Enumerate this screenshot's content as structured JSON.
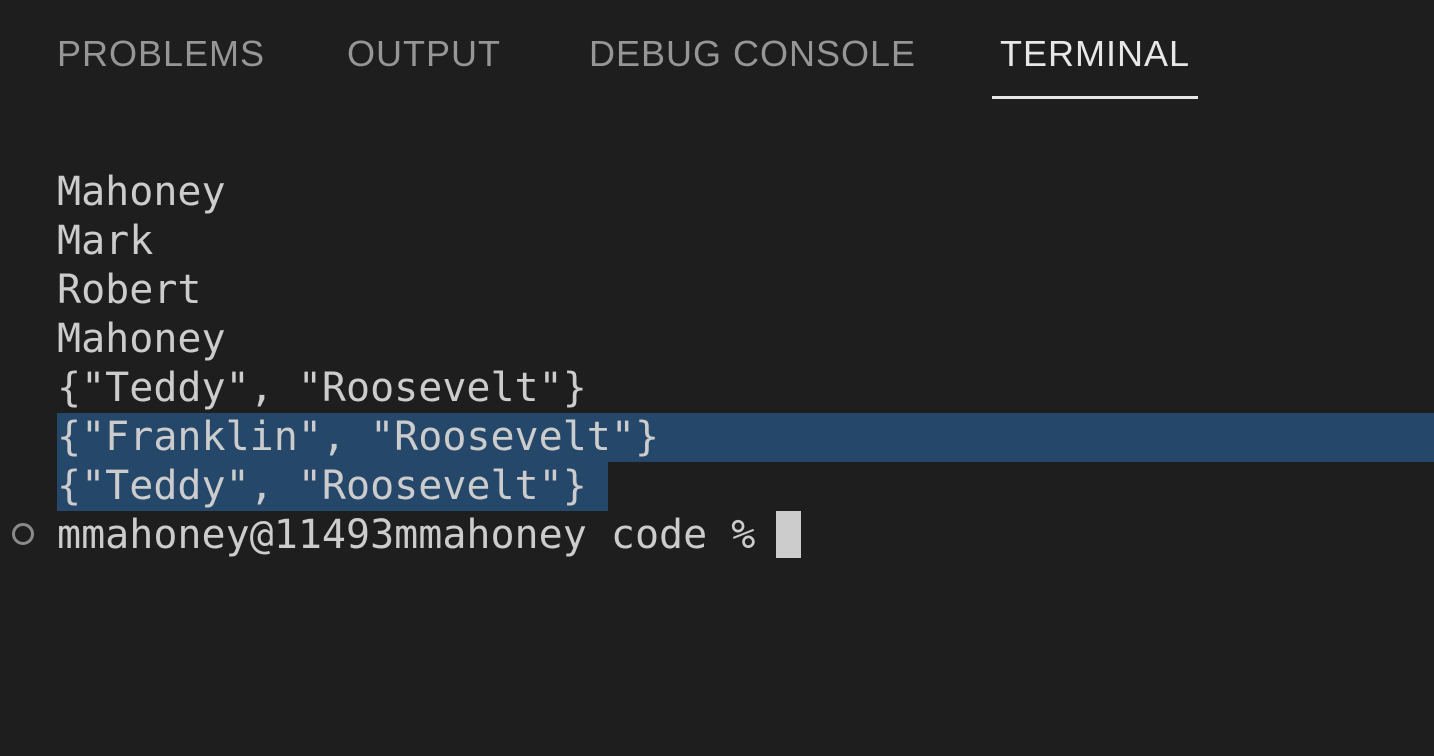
{
  "tabs": {
    "problems": "PROBLEMS",
    "output": "OUTPUT",
    "debug_console": "DEBUG CONSOLE",
    "terminal": "TERMINAL",
    "active": "TERMINAL"
  },
  "terminal": {
    "lines": [
      "Mahoney",
      "Mark",
      "Robert",
      "Mahoney",
      "{\"Teddy\", \"Roosevelt\"}",
      "{\"Franklin\", \"Roosevelt\"}",
      "{\"Teddy\", \"Roosevelt\"}"
    ],
    "prompt": "mmahoney@11493mmahoney code % "
  },
  "colors": {
    "background": "#1e1e1e",
    "selection": "#264f78",
    "active_tab": "#e7e7e7",
    "inactive_tab": "#969696",
    "text": "#cccccc"
  }
}
